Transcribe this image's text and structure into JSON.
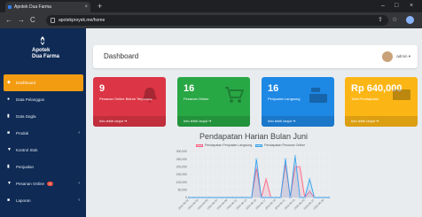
{
  "browser": {
    "tab_title": "Apotek Dua Farma",
    "tab_close": "×",
    "new_tab": "+",
    "url": "apotekproyek.me/home",
    "window_controls": [
      "–",
      "□",
      "×"
    ],
    "nav": [
      "←",
      "→",
      "C"
    ]
  },
  "sidebar": {
    "brand": {
      "line1": "Apotek",
      "line2": "Dua Farma",
      "logo_icon": "pharmacy-logo-icon"
    },
    "items": [
      {
        "label": "Dashboard",
        "icon": "dashboard-icon",
        "glyph": "◆",
        "active": true,
        "caret": ""
      },
      {
        "label": "Data Pelanggan",
        "icon": "users-icon",
        "glyph": "●",
        "active": false,
        "caret": ""
      },
      {
        "label": "Data Dagla",
        "icon": "chart-icon",
        "glyph": "▮",
        "active": false,
        "caret": ""
      },
      {
        "label": "Produk",
        "icon": "product-icon",
        "glyph": "■",
        "active": false,
        "caret": "‹"
      },
      {
        "label": "Kontrol Stok",
        "icon": "filter-icon",
        "glyph": "▼",
        "active": false,
        "caret": ""
      },
      {
        "label": "Penjualan",
        "icon": "sales-icon",
        "glyph": "▮",
        "active": false,
        "caret": ""
      },
      {
        "label": "Pesanan Online",
        "icon": "cart-icon",
        "glyph": "▼",
        "active": false,
        "caret": "‹",
        "badge": "9"
      },
      {
        "label": "Laporan",
        "icon": "report-icon",
        "glyph": "■",
        "active": false,
        "caret": "‹"
      }
    ]
  },
  "header": {
    "title": "Dashboard",
    "user": "admin ▾"
  },
  "cards": [
    {
      "value": "9",
      "label": "Pesanan Online Belum Terproses",
      "footer": "Info lebih lanjut ➔",
      "color": "#dc3545",
      "icon": "bell-icon"
    },
    {
      "value": "16",
      "label": "Pesanan Online",
      "footer": "Info lebih lanjut ➔",
      "color": "#28a745",
      "icon": "cart-icon"
    },
    {
      "value": "16",
      "label": "Penjualan Langsung",
      "footer": "Info lebih lanjut ➔",
      "color": "#1e88e5",
      "icon": "cash-register-icon"
    },
    {
      "value": "Rp 640,000",
      "label": "Total Pendapatan",
      "footer": "Info lebih lanjut ➔",
      "color": "#fbb615",
      "icon": "money-icon"
    }
  ],
  "chart_data": {
    "type": "line",
    "title": "Pendapatan Harian Bulan Juni",
    "xlabel": "",
    "ylabel": "",
    "ylim": [
      0,
      300000
    ],
    "yticks": [
      "300,000",
      "250,000",
      "200,000",
      "150,000",
      "100,000",
      "50,000",
      "0"
    ],
    "x": [
      "2024-06-01",
      "2024-06-02",
      "2024-06-03",
      "2024-06-04",
      "2024-06-05",
      "2024-06-06",
      "2024-06-07",
      "2024-06-08",
      "2024-06-09",
      "2024-06-10",
      "2024-06-11",
      "2024-06-12",
      "2024-06-13",
      "2024-06-14",
      "2024-06-15",
      "2024-06-16",
      "2024-06-17",
      "2024-06-18",
      "2024-06-19",
      "2024-06-20",
      "2024-06-21",
      "2024-06-22",
      "2024-06-23",
      "2024-06-24",
      "2024-06-25",
      "2024-06-26",
      "2024-06-27",
      "2024-06-28",
      "2024-06-29",
      "2024-06-30"
    ],
    "series": [
      {
        "name": "Pendapatan Penjualan Langsung",
        "color": "#ff6384",
        "values": [
          0,
          0,
          0,
          0,
          0,
          0,
          0,
          0,
          0,
          0,
          0,
          0,
          0,
          0,
          190000,
          0,
          120000,
          0,
          0,
          0,
          220000,
          0,
          200000,
          200000,
          0,
          40000,
          0,
          0,
          0,
          0
        ]
      },
      {
        "name": "Pendapatan Pesanan Online",
        "color": "#36a2eb",
        "values": [
          0,
          0,
          0,
          0,
          0,
          0,
          0,
          0,
          0,
          0,
          0,
          0,
          0,
          0,
          250000,
          0,
          0,
          0,
          0,
          0,
          250000,
          0,
          270000,
          0,
          0,
          120000,
          0,
          0,
          0,
          0
        ]
      }
    ]
  }
}
